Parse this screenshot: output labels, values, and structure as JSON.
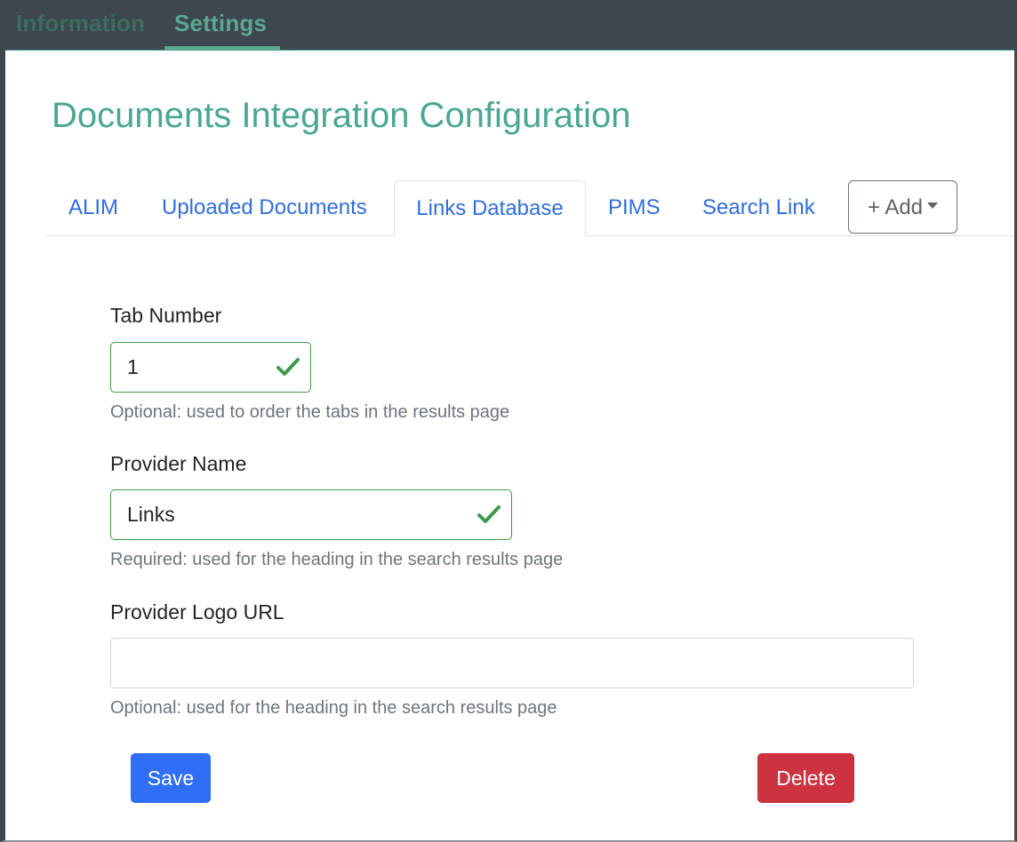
{
  "topnav": {
    "information": "Information",
    "settings": "Settings"
  },
  "page": {
    "title": "Documents Integration Configuration"
  },
  "tabs": [
    {
      "label": "ALIM",
      "active": false
    },
    {
      "label": "Uploaded Documents",
      "active": false
    },
    {
      "label": "Links Database",
      "active": true
    },
    {
      "label": "PIMS",
      "active": false
    },
    {
      "label": "Search Link",
      "active": false
    }
  ],
  "add_button": {
    "label": "+ Add"
  },
  "form": {
    "tab_number": {
      "label": "Tab Number",
      "value": "1",
      "help": "Optional: used to order the tabs in the results page",
      "valid_icon": "check-icon"
    },
    "provider_name": {
      "label": "Provider Name",
      "value": "Links",
      "help": "Required: used for the heading in the search results page",
      "valid_icon": "check-icon"
    },
    "provider_logo_url": {
      "label": "Provider Logo URL",
      "value": "",
      "help": "Optional: used for the heading in the search results page"
    }
  },
  "actions": {
    "save_label": "Save",
    "delete_label": "Delete"
  },
  "colors": {
    "topbar": "#3e4750",
    "title": "#4aa795",
    "link": "#2f6ee0",
    "valid": "#3f9a4a",
    "save": "#2f6ef5",
    "delete": "#cc3240"
  }
}
